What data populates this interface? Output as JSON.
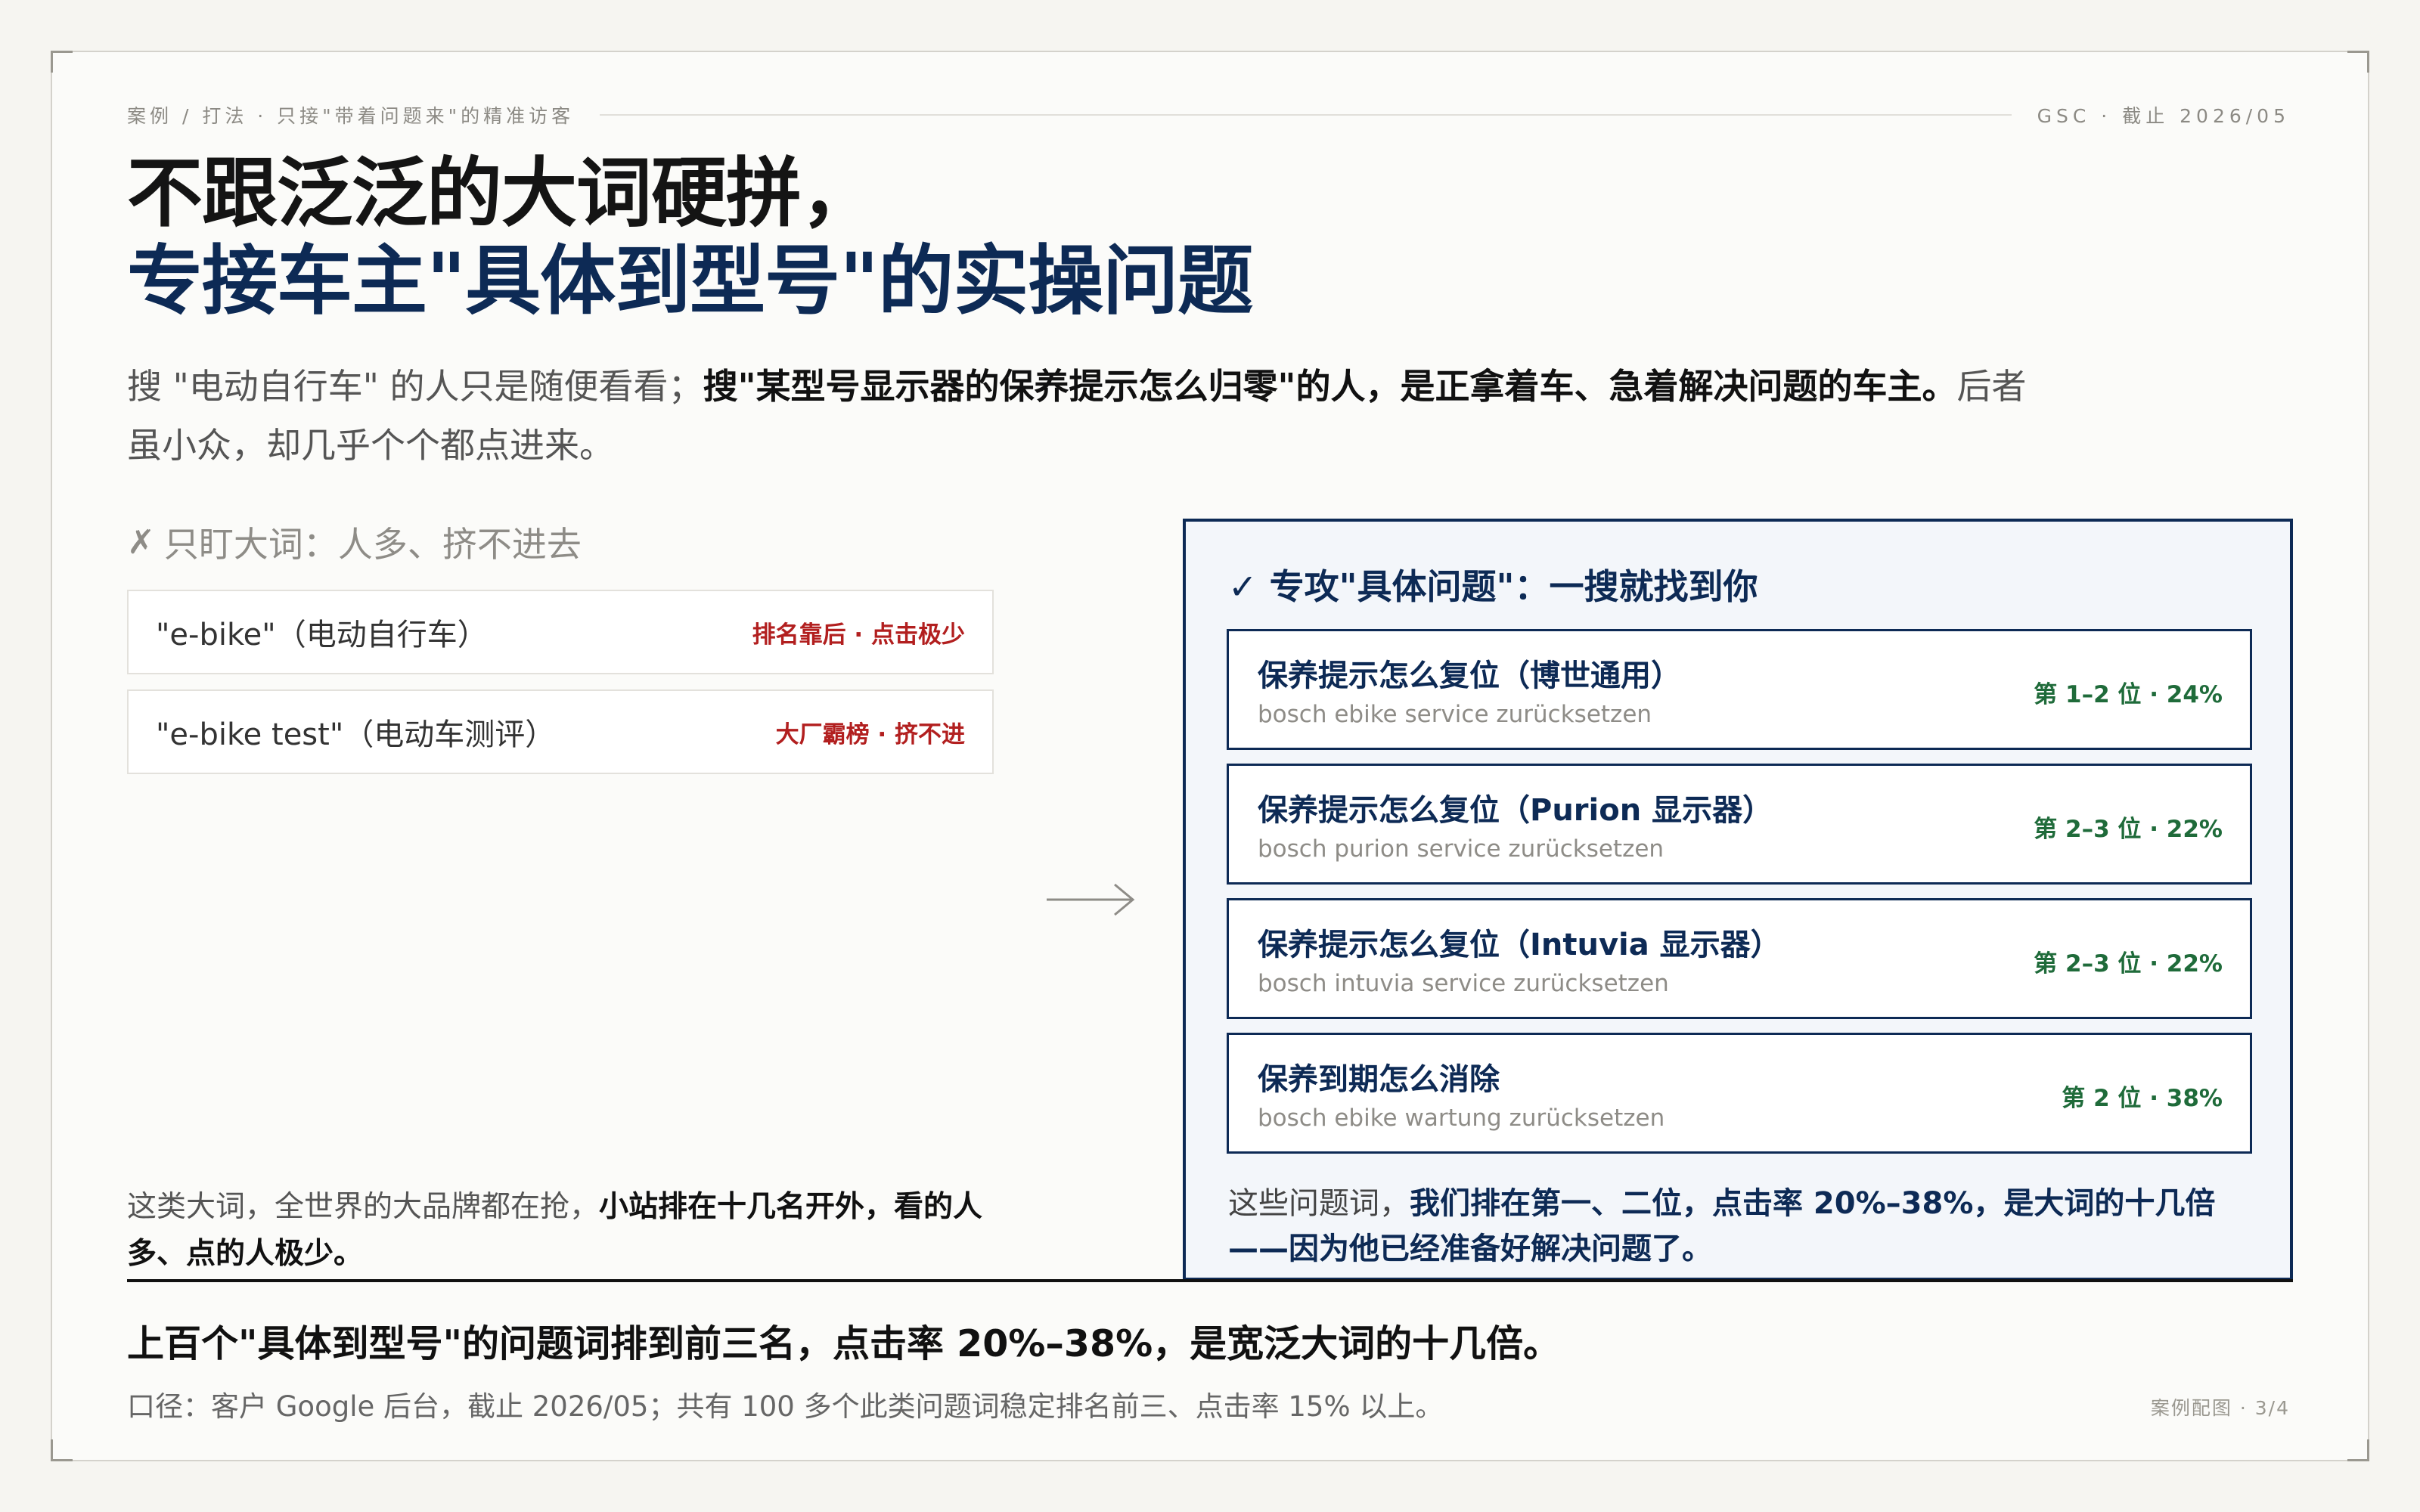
{
  "header": {
    "breadcrumb": "案例 / 打法 · 只接\"带着问题来\"的精准访客",
    "meta": "GSC · 截止 2026/05"
  },
  "title": {
    "line1": "不跟泛泛的大词硬拼，",
    "line2": "专接车主\"具体到型号\"的实操问题"
  },
  "lead": {
    "plain_1": "搜 \"电动自行车\" 的人只是随便看看；",
    "bold": "搜\"某型号显示器的保养提示怎么归零\"的人，是正拿着车、急着解决问题的车主。",
    "plain_2": "后者虽小众，却几乎个个都点进来。"
  },
  "left_column": {
    "heading_icon": "✗",
    "heading": "只盯大词：人多、挤不进去",
    "keywords": [
      {
        "term": "\"e-bike\"（电动自行车）",
        "tag": "排名靠后 · 点击极少"
      },
      {
        "term": "\"e-bike test\"（电动车测评）",
        "tag": "大厂霸榜 · 挤不进"
      }
    ],
    "footnote_plain": "这类大词，全世界的大品牌都在抢，",
    "footnote_bold": "小站排在十几名开外，看的人多、点的人极少。"
  },
  "right_column": {
    "heading_icon": "✓",
    "heading": "专攻\"具体问题\"：一搜就找到你",
    "questions": [
      {
        "title": "保养提示怎么复位（博世通用）",
        "query": "bosch ebike service zurücksetzen",
        "rank": "第 1–2 位 · 24%"
      },
      {
        "title": "保养提示怎么复位（Purion 显示器）",
        "query": "bosch purion service zurücksetzen",
        "rank": "第 2–3 位 · 22%"
      },
      {
        "title": "保养提示怎么复位（Intuvia 显示器）",
        "query": "bosch intuvia service zurücksetzen",
        "rank": "第 2–3 位 · 22%"
      },
      {
        "title": "保养到期怎么消除",
        "query": "bosch ebike wartung zurücksetzen",
        "rank": "第 2 位 · 38%"
      }
    ],
    "footnote_plain": "这些问题词，",
    "footnote_bold": "我们排在第一、二位，点击率 20%–38%，是大词的十几倍——因为他已经准备好解决问题了。"
  },
  "conclusion": "上百个\"具体到型号\"的问题词排到前三名，点击率 20%–38%，是宽泛大词的十几倍。",
  "source": "口径：客户 Google 后台，截止 2026/05；共有 100 多个此类问题词稳定排名前三、点击率 15% 以上。",
  "pager": "案例配图 · 3/4",
  "colors": {
    "navy": "#0d2a55",
    "red_tag": "#b21f1f",
    "green_rank": "#1f6b3a"
  }
}
